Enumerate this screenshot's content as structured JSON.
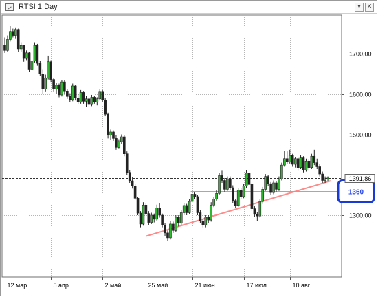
{
  "window": {
    "title": "RTSI 1 Day",
    "buttons": [
      {
        "name": "window-menu-button",
        "glyph": "▾"
      },
      {
        "name": "window-close-button",
        "glyph": "✕"
      }
    ]
  },
  "chart_data": {
    "type": "candlestick",
    "symbol": "RTSI",
    "timeframe": "1 Day",
    "ylim": [
      1228,
      1790
    ],
    "y_ticks": [
      {
        "value": 1700,
        "label": "1700,00"
      },
      {
        "value": 1600,
        "label": "1600,00"
      },
      {
        "value": 1500,
        "label": "1500,00"
      },
      {
        "value": 1300,
        "label": "1300,00"
      }
    ],
    "x_ticks": [
      {
        "bar": 0,
        "label": "12 мар"
      },
      {
        "bar": 17,
        "label": "5 апр"
      },
      {
        "bar": 36,
        "label": "2 май"
      },
      {
        "bar": 52,
        "label": "25 май"
      },
      {
        "bar": 69,
        "label": "21 июн"
      },
      {
        "bar": 88,
        "label": "17 июл"
      },
      {
        "bar": 105,
        "label": "10 авг"
      }
    ],
    "current_price": {
      "value": 1391.86,
      "label": "1391,86"
    },
    "horizontal_levels": [
      {
        "value": 1360,
        "label": "1360",
        "color": "#2c49e8"
      }
    ],
    "trendline": {
      "from": {
        "bar": 52,
        "price": 1248
      },
      "to": {
        "bar": 120,
        "price": 1385
      },
      "color": "#ff8a8a"
    },
    "candle_colors": {
      "up": "#2eb82e",
      "down": "#222222"
    },
    "candles": [
      [
        1720,
        1740,
        1702,
        1708
      ],
      [
        1708,
        1745,
        1705,
        1735
      ],
      [
        1735,
        1768,
        1730,
        1755
      ],
      [
        1755,
        1762,
        1740,
        1745
      ],
      [
        1745,
        1765,
        1738,
        1760
      ],
      [
        1760,
        1762,
        1705,
        1712
      ],
      [
        1712,
        1728,
        1705,
        1720
      ],
      [
        1720,
        1722,
        1680,
        1688
      ],
      [
        1688,
        1708,
        1684,
        1702
      ],
      [
        1702,
        1705,
        1655,
        1660
      ],
      [
        1660,
        1690,
        1652,
        1682
      ],
      [
        1682,
        1728,
        1678,
        1720
      ],
      [
        1720,
        1724,
        1670,
        1676
      ],
      [
        1676,
        1682,
        1645,
        1650
      ],
      [
        1650,
        1660,
        1600,
        1612
      ],
      [
        1612,
        1648,
        1605,
        1640
      ],
      [
        1640,
        1695,
        1636,
        1680
      ],
      [
        1680,
        1684,
        1630,
        1636
      ],
      [
        1636,
        1640,
        1605,
        1612
      ],
      [
        1612,
        1628,
        1600,
        1622
      ],
      [
        1622,
        1626,
        1592,
        1598
      ],
      [
        1598,
        1635,
        1594,
        1630
      ],
      [
        1630,
        1634,
        1600,
        1606
      ],
      [
        1606,
        1612,
        1588,
        1594
      ],
      [
        1594,
        1602,
        1580,
        1586
      ],
      [
        1586,
        1626,
        1582,
        1620
      ],
      [
        1620,
        1622,
        1584,
        1590
      ],
      [
        1590,
        1600,
        1575,
        1580
      ],
      [
        1580,
        1610,
        1576,
        1604
      ],
      [
        1604,
        1606,
        1576,
        1582
      ],
      [
        1582,
        1596,
        1568,
        1588
      ],
      [
        1588,
        1592,
        1568,
        1574
      ],
      [
        1574,
        1598,
        1570,
        1592
      ],
      [
        1592,
        1596,
        1576,
        1580
      ],
      [
        1580,
        1592,
        1572,
        1588
      ],
      [
        1588,
        1612,
        1584,
        1605
      ],
      [
        1605,
        1610,
        1580,
        1585
      ],
      [
        1585,
        1590,
        1545,
        1550
      ],
      [
        1550,
        1554,
        1490,
        1498
      ],
      [
        1498,
        1512,
        1486,
        1506
      ],
      [
        1506,
        1510,
        1484,
        1490
      ],
      [
        1490,
        1498,
        1462,
        1468
      ],
      [
        1468,
        1488,
        1464,
        1482
      ],
      [
        1482,
        1500,
        1476,
        1494
      ],
      [
        1494,
        1498,
        1446,
        1452
      ],
      [
        1452,
        1458,
        1400,
        1406
      ],
      [
        1406,
        1412,
        1380,
        1385
      ],
      [
        1385,
        1394,
        1366,
        1372
      ],
      [
        1372,
        1378,
        1338,
        1342
      ],
      [
        1342,
        1346,
        1300,
        1305
      ],
      [
        1305,
        1310,
        1270,
        1278
      ],
      [
        1278,
        1332,
        1274,
        1325
      ],
      [
        1325,
        1330,
        1300,
        1304
      ],
      [
        1304,
        1310,
        1276,
        1282
      ],
      [
        1282,
        1306,
        1278,
        1300
      ],
      [
        1300,
        1304,
        1282,
        1290
      ],
      [
        1290,
        1326,
        1286,
        1318
      ],
      [
        1318,
        1330,
        1294,
        1300
      ],
      [
        1300,
        1304,
        1270,
        1275
      ],
      [
        1275,
        1280,
        1248,
        1256
      ],
      [
        1256,
        1262,
        1236,
        1244
      ],
      [
        1244,
        1286,
        1240,
        1278
      ],
      [
        1278,
        1284,
        1256,
        1262
      ],
      [
        1262,
        1300,
        1258,
        1295
      ],
      [
        1295,
        1300,
        1272,
        1280
      ],
      [
        1280,
        1312,
        1276,
        1306
      ],
      [
        1306,
        1330,
        1300,
        1324
      ],
      [
        1324,
        1328,
        1300,
        1306
      ],
      [
        1306,
        1340,
        1302,
        1334
      ],
      [
        1334,
        1358,
        1330,
        1352
      ],
      [
        1352,
        1356,
        1340,
        1346
      ],
      [
        1346,
        1350,
        1300,
        1306
      ],
      [
        1306,
        1312,
        1280,
        1286
      ],
      [
        1286,
        1290,
        1270,
        1276
      ],
      [
        1276,
        1300,
        1270,
        1295
      ],
      [
        1295,
        1300,
        1280,
        1288
      ],
      [
        1288,
        1332,
        1284,
        1325
      ],
      [
        1325,
        1345,
        1320,
        1340
      ],
      [
        1340,
        1362,
        1336,
        1354
      ],
      [
        1354,
        1404,
        1350,
        1398
      ],
      [
        1398,
        1410,
        1380,
        1386
      ],
      [
        1386,
        1392,
        1358,
        1364
      ],
      [
        1364,
        1396,
        1360,
        1390
      ],
      [
        1390,
        1396,
        1362,
        1368
      ],
      [
        1368,
        1374,
        1330,
        1336
      ],
      [
        1336,
        1340,
        1318,
        1324
      ],
      [
        1324,
        1368,
        1320,
        1362
      ],
      [
        1362,
        1368,
        1340,
        1346
      ],
      [
        1346,
        1378,
        1342,
        1372
      ],
      [
        1372,
        1412,
        1368,
        1405
      ],
      [
        1405,
        1410,
        1370,
        1376
      ],
      [
        1376,
        1380,
        1310,
        1316
      ],
      [
        1316,
        1322,
        1296,
        1302
      ],
      [
        1302,
        1308,
        1286,
        1298
      ],
      [
        1298,
        1340,
        1294,
        1334
      ],
      [
        1334,
        1370,
        1328,
        1364
      ],
      [
        1364,
        1402,
        1360,
        1396
      ],
      [
        1396,
        1400,
        1372,
        1378
      ],
      [
        1378,
        1382,
        1350,
        1356
      ],
      [
        1356,
        1386,
        1352,
        1380
      ],
      [
        1380,
        1384,
        1358,
        1364
      ],
      [
        1364,
        1396,
        1360,
        1390
      ],
      [
        1390,
        1430,
        1386,
        1424
      ],
      [
        1424,
        1460,
        1420,
        1440
      ],
      [
        1440,
        1458,
        1426,
        1432
      ],
      [
        1432,
        1462,
        1428,
        1448
      ],
      [
        1448,
        1452,
        1420,
        1426
      ],
      [
        1426,
        1444,
        1418,
        1440
      ],
      [
        1440,
        1444,
        1410,
        1418
      ],
      [
        1418,
        1448,
        1414,
        1442
      ],
      [
        1442,
        1446,
        1406,
        1412
      ],
      [
        1412,
        1440,
        1408,
        1434
      ],
      [
        1434,
        1438,
        1410,
        1418
      ],
      [
        1418,
        1452,
        1414,
        1446
      ],
      [
        1446,
        1462,
        1424,
        1430
      ],
      [
        1430,
        1440,
        1414,
        1420
      ],
      [
        1420,
        1426,
        1396,
        1402
      ],
      [
        1402,
        1408,
        1380,
        1386
      ],
      [
        1386,
        1396,
        1380,
        1390
      ],
      [
        1390,
        1396,
        1384,
        1392
      ]
    ]
  }
}
